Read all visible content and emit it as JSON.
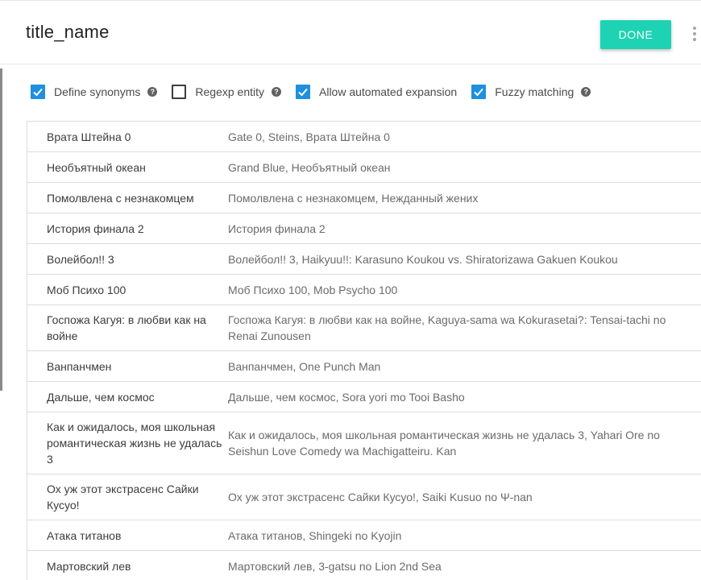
{
  "header": {
    "title": "title_name",
    "done_label": "DONE",
    "more_icon": "more-vert-icon"
  },
  "options": [
    {
      "label": "Define synonyms",
      "checked": true,
      "help": "?"
    },
    {
      "label": "Regexp entity",
      "checked": false,
      "help": "?"
    },
    {
      "label": "Allow automated expansion",
      "checked": true,
      "help": null
    },
    {
      "label": "Fuzzy matching",
      "checked": true,
      "help": "?"
    }
  ],
  "colors": {
    "accent_button": "#1ed3b4",
    "checkbox_checked": "#1f8fe0"
  },
  "rows": [
    {
      "name": "Врата Штейна 0",
      "synonyms": "Gate 0, Steins, Врата Штейна 0"
    },
    {
      "name": "Необъятный океан",
      "synonyms": "Grand Blue, Необъятный океан"
    },
    {
      "name": "Помолвлена с незнакомцем",
      "synonyms": "Помолвлена с незнакомцем, Нежданный жених"
    },
    {
      "name": "История финала 2",
      "synonyms": "История финала 2"
    },
    {
      "name": "Волейбол!! 3",
      "synonyms": "Волейбол!! 3, Haikyuu!!: Karasuno Koukou vs. Shiratorizawa Gakuen Koukou"
    },
    {
      "name": "Моб Психо 100",
      "synonyms": "Моб Психо 100, Mob Psycho 100"
    },
    {
      "name": "Госпожа Кагуя: в любви как на войне",
      "synonyms": "Госпожа Кагуя: в любви как на войне, Kaguya-sama wa Kokurasetai?: Tensai-tachi no Renai Zunousen"
    },
    {
      "name": "Ванпанчмен",
      "synonyms": "Ванпанчмен, One Punch Man"
    },
    {
      "name": "Дальше, чем космос",
      "synonyms": "Дальше, чем космос, Sora yori mo Tooi Basho"
    },
    {
      "name": "Как и ожидалось, моя школьная романтическая жизнь не удалась 3",
      "synonyms": "Как и ожидалось, моя школьная романтическая жизнь не удалась 3, Yahari Ore no Seishun Love Comedy wa Machigatteiru. Kan"
    },
    {
      "name": "Ох уж этот экстрасенс Сайки Кусуо!",
      "synonyms": "Ох уж этот экстрасенс Сайки Кусуо!, Saiki Kusuo no Ψ-nan"
    },
    {
      "name": "Атака титанов",
      "synonyms": "Атака титанов, Shingeki no Kyojin"
    },
    {
      "name": "Мартовский лев",
      "synonyms": "Мартовский лев, 3-gatsu no Lion 2nd Sea"
    }
  ]
}
